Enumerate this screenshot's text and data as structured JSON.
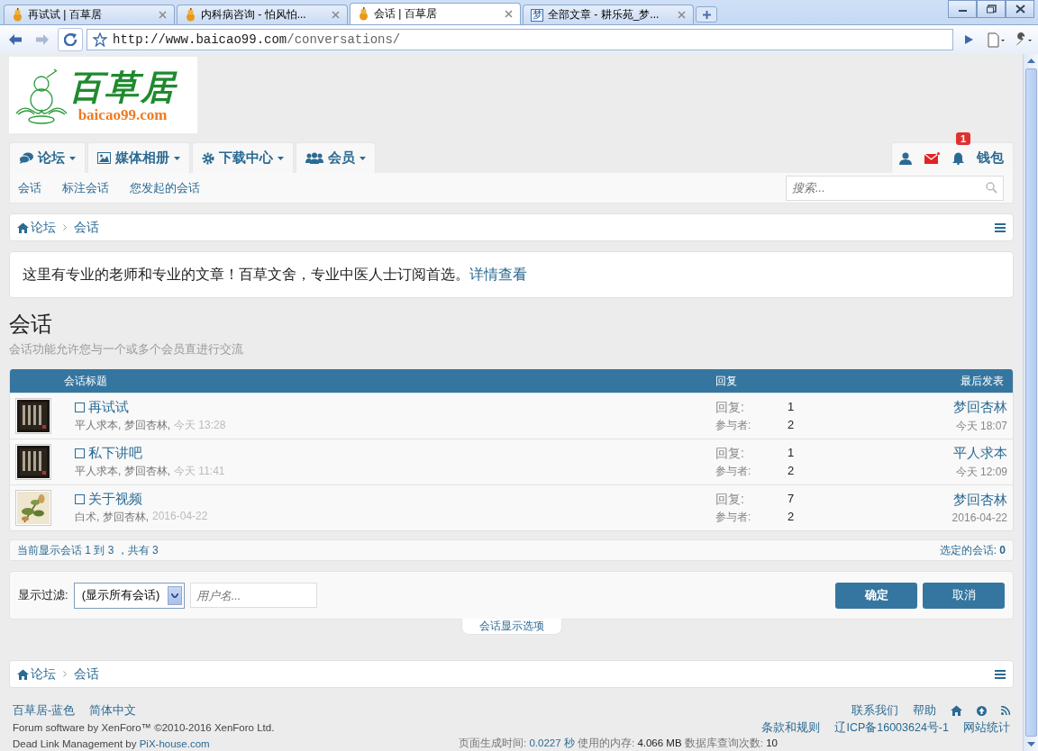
{
  "browser": {
    "tabs": [
      {
        "title": "再试试 | 百草居",
        "selected": false
      },
      {
        "title": "内科病咨询 - 怕风怕...",
        "selected": false
      },
      {
        "title": "会话 | 百草居",
        "selected": true
      },
      {
        "title": "全部文章 - 耕乐苑_梦...",
        "favicon_char": "梦",
        "selected": false
      }
    ],
    "url_host": "http://www.baicao99.com",
    "url_path": "/conversations/"
  },
  "logo": {
    "name": "百草居",
    "domain": "baicao99.com"
  },
  "nav": {
    "tabs": [
      {
        "label": "论坛"
      },
      {
        "label": "媒体相册"
      },
      {
        "label": "下载中心"
      },
      {
        "label": "会员"
      }
    ],
    "notification_count": "1",
    "wallet": "钱包"
  },
  "subnav": {
    "items": [
      "会话",
      "标注会话",
      "您发起的会话"
    ],
    "search_placeholder": "搜索..."
  },
  "breadcrumb_top": [
    "论坛",
    "会话"
  ],
  "notice": {
    "text": "这里有专业的老师和专业的文章！百草文舍，专业中医人士订阅首选。",
    "link": "详情查看"
  },
  "page_title": "会话",
  "page_description": "会话功能允许您与一个或多个会员直进行交流",
  "table": {
    "columns": [
      "会话标题",
      "回复",
      "最后发表"
    ],
    "rows": [
      {
        "title": "再试试",
        "checked": false,
        "participants": "平人求本, 梦回杏林,",
        "time": "今天 13:28",
        "replies_label": "回复:",
        "replies": "1",
        "participants_label": "参与者:",
        "participant_count": "2",
        "last_user": "梦回杏林",
        "last_time": "今天 18:07"
      },
      {
        "title": "私下讲吧",
        "checked": false,
        "participants": "平人求本, 梦回杏林,",
        "time": "今天 11:41",
        "replies_label": "回复:",
        "replies": "1",
        "participants_label": "参与者:",
        "participant_count": "2",
        "last_user": "平人求本",
        "last_time": "今天 12:09"
      },
      {
        "title": "关于视频",
        "checked": false,
        "participants": "白术, 梦回杏林,",
        "time": "2016-04-22",
        "replies_label": "回复:",
        "replies": "7",
        "participants_label": "参与者:",
        "participant_count": "2",
        "last_user": "梦回杏林",
        "last_time": "2016-04-22"
      }
    ]
  },
  "summary": {
    "left": "当前显示会话 1 到 3 ，共有 3",
    "right": "选定的会话: **0**"
  },
  "filter": {
    "label": "显示过滤:",
    "select_value": "(显示所有会话)",
    "user_placeholder": "用户名...",
    "buttons": [
      "确定",
      "取消"
    ],
    "options_tab": "会话显示选项"
  },
  "breadcrumb_bottom": [
    "论坛",
    "会话"
  ],
  "footer": {
    "left_links": [
      "百草居-蓝色",
      "简体中文"
    ],
    "right_links": [
      "联系我们",
      "帮助"
    ],
    "copyright": "Forum software by XenForo™ ©2010-2016 XenForo Ltd.",
    "deadlink_text": "Dead Link Management by",
    "deadlink_link": "PiX-house.com",
    "legal_links": [
      "条款和规则",
      "辽ICP备16003624号-1",
      "网站统计"
    ],
    "stats": [
      {
        "label": "页面生成时间:",
        "value": "0.0227 秒"
      },
      {
        "label": "使用的内存:",
        "value": "4.066 MB"
      },
      {
        "label": "数据库查询次数:",
        "value": "10"
      }
    ]
  }
}
